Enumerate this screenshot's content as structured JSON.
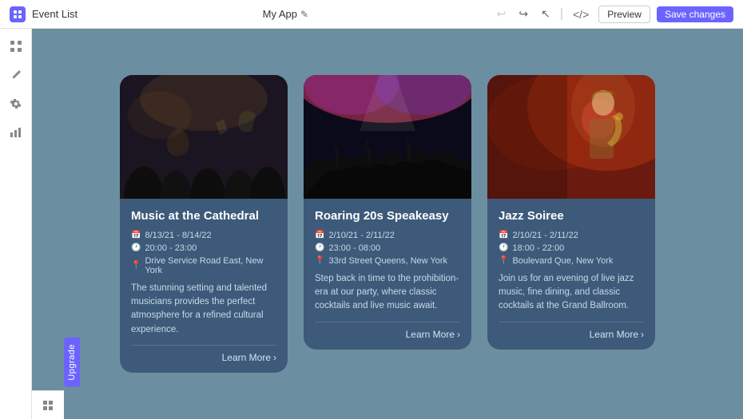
{
  "app": {
    "name": "My App",
    "edit_icon": "✎",
    "section": "Event List"
  },
  "topbar": {
    "undo_label": "↩",
    "redo_label": "↪",
    "cursor_label": "↖",
    "code_label": "</>",
    "preview_label": "Preview",
    "save_label": "Save changes"
  },
  "sidebar": {
    "items": [
      {
        "icon": "⊞",
        "label": "grid-icon",
        "active": false
      },
      {
        "icon": "✎",
        "label": "pen-icon",
        "active": false
      },
      {
        "icon": "⚙",
        "label": "settings-icon",
        "active": false
      },
      {
        "icon": "📊",
        "label": "chart-icon",
        "active": false
      }
    ]
  },
  "cards": [
    {
      "id": "card-orchestra",
      "title": "Music at the Cathedral",
      "date": "8/13/21 - 8/14/22",
      "time": "20:00 - 23:00",
      "location": "Drive Service Road East, New York",
      "description": "The stunning setting and talented musicians provides the perfect atmosphere for a refined cultural experience.",
      "learn_more": "Learn More",
      "image_type": "orchestra"
    },
    {
      "id": "card-club",
      "title": "Roaring 20s Speakeasy",
      "date": "2/10/21 - 2/11/22",
      "time": "23:00 - 08:00",
      "location": "33rd Street Queens, New York",
      "description": "Step back in time to the prohibition-era at our party, where classic cocktails and live music await.",
      "learn_more": "Learn More",
      "image_type": "club"
    },
    {
      "id": "card-jazz",
      "title": "Jazz Soiree",
      "date": "2/10/21 - 2/11/22",
      "time": "18:00 - 22:00",
      "location": "Boulevard Que, New York",
      "description": "Join us for an evening of live jazz music, fine dining, and classic cocktails at the Grand Ballroom.",
      "learn_more": "Learn More",
      "image_type": "jazz"
    }
  ],
  "upgrade": {
    "label": "Upgrade"
  }
}
